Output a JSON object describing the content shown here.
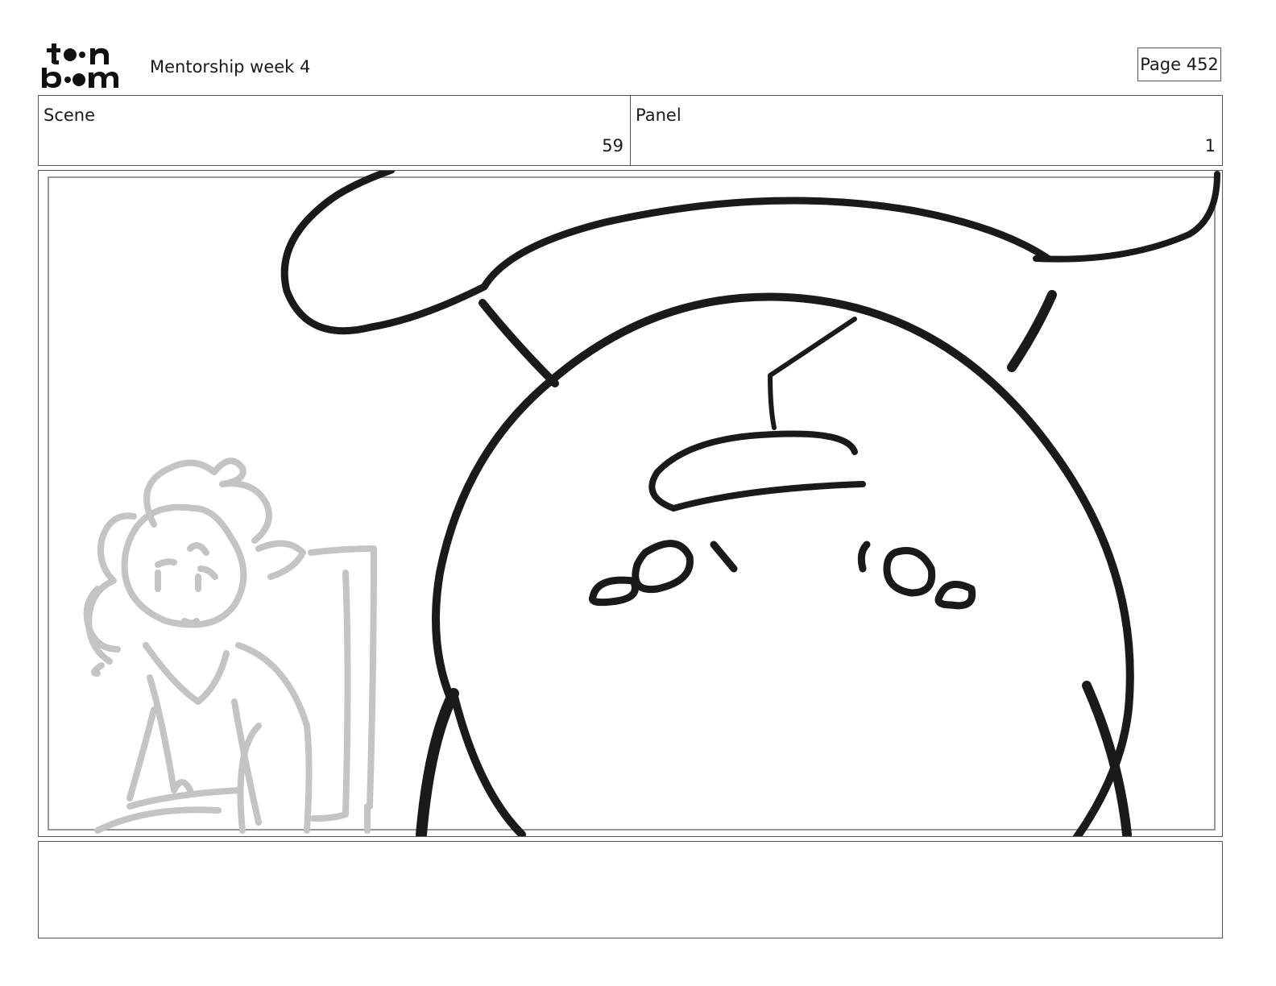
{
  "header": {
    "logo_text": "toon boom",
    "title": "Mentorship week 4",
    "page_label": "Page 452"
  },
  "info": {
    "scene_label": "Scene",
    "scene_value": "59",
    "panel_label": "Panel",
    "panel_value": "1"
  },
  "frame": {
    "description_icon": "storyboard-sketch"
  },
  "notes": {
    "text": ""
  }
}
